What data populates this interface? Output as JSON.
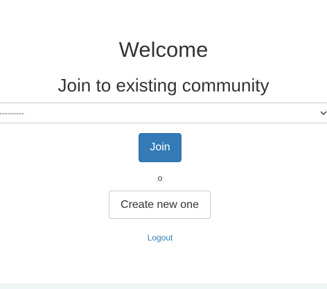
{
  "page": {
    "welcome_heading": "Welcome",
    "join_heading": "Join to existing community"
  },
  "community_select": {
    "selected_value": "---------"
  },
  "actions": {
    "join_label": "Join",
    "or_label": "o",
    "create_label": "Create new one",
    "logout_label": "Logout"
  },
  "colors": {
    "primary": "#337ab7",
    "text": "#333333",
    "border": "#cccccc"
  },
  "icons": {
    "select_arrow": "chevron-down-icon"
  }
}
